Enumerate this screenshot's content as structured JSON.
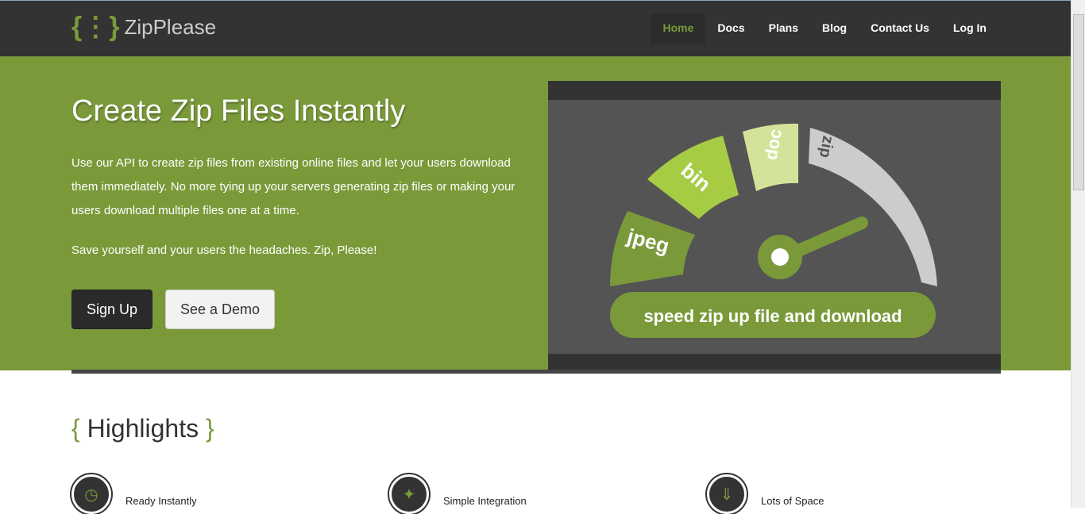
{
  "brand": "ZipPlease",
  "nav": [
    "Home",
    "Docs",
    "Plans",
    "Blog",
    "Contact Us",
    "Log In"
  ],
  "hero": {
    "title": "Create Zip Files Instantly",
    "desc": "Use our API to create zip files from existing online files and let your users download them immediately. No more tying up your servers generating zip files or making your users download multiple files one at a time.",
    "tagline": "Save yourself and your users the headaches. Zip, Please!",
    "signup": "Sign Up",
    "demo": "See a Demo"
  },
  "graphic": {
    "segments": [
      "jpeg",
      "bin",
      "doc",
      "zip"
    ],
    "caption": "speed zip up file and download"
  },
  "highlights": {
    "title": "Highlights",
    "open": "{",
    "close": "}",
    "items": [
      "Ready Instantly",
      "Simple Integration",
      "Lots of Space"
    ]
  }
}
